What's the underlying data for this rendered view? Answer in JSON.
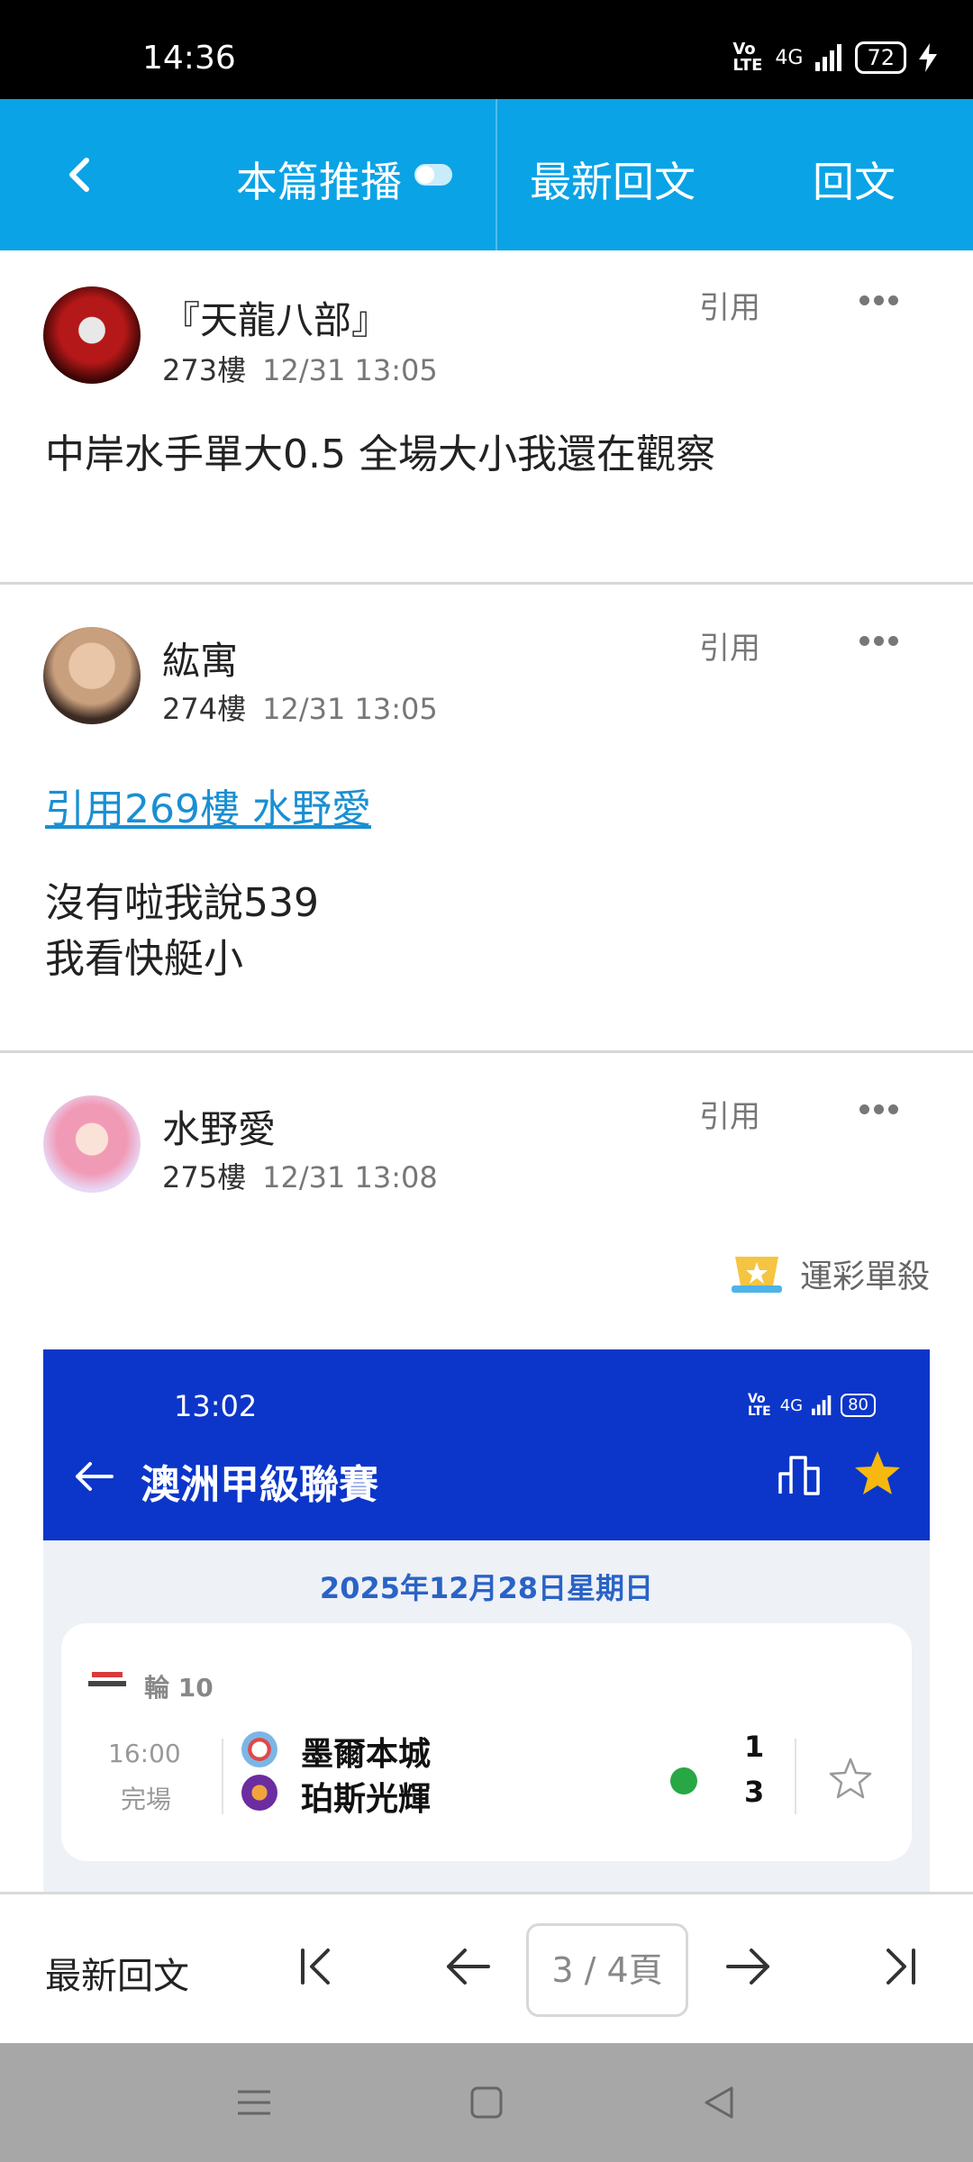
{
  "status_bar": {
    "time": "14:36",
    "network": "4G",
    "battery": "72"
  },
  "header": {
    "push_tab": "本篇推播",
    "latest_tab": "最新回文",
    "reply_tab": "回文"
  },
  "posts": [
    {
      "username": "『天龍八部』",
      "floor": "273樓",
      "time": "12/31 13:05",
      "quote_label": "引用",
      "content": "中岸水手單大0.5 全場大小我還在觀察"
    },
    {
      "username": "紘寓",
      "floor": "274樓",
      "time": "12/31 13:05",
      "quote_label": "引用",
      "quote_link": "引用269樓 水野愛",
      "content_lines": [
        "沒有啦我說539",
        "我看快艇小"
      ]
    },
    {
      "username": "水野愛",
      "floor": "275樓",
      "time": "12/31 13:08",
      "quote_label": "引用",
      "badge": "運彩單殺",
      "embedded_screenshot": {
        "status_time": "13:02",
        "network": "4G",
        "battery": "80",
        "title": "澳洲甲級聯賽",
        "date": "2025年12月28日星期日",
        "round": "輪 10",
        "match_time": "16:00",
        "match_status": "完場",
        "home_team": "墨爾本城",
        "away_team": "珀斯光輝",
        "home_score": "1",
        "away_score": "3"
      }
    }
  ],
  "bottom_bar": {
    "latest_label": "最新回文",
    "page_indicator": "3 / 4頁"
  },
  "colors": {
    "header_bg": "#0aa3e6",
    "link": "#1a8fd2",
    "embed_header": "#0c36c9"
  }
}
